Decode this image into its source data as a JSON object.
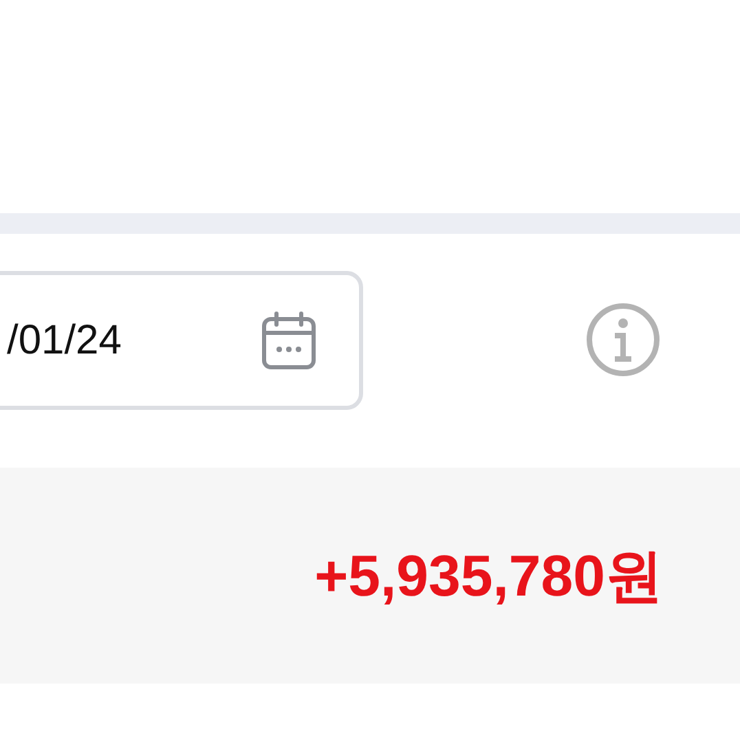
{
  "date_field": {
    "value": "/01/24"
  },
  "total": {
    "amount": "+5,935,780원"
  }
}
